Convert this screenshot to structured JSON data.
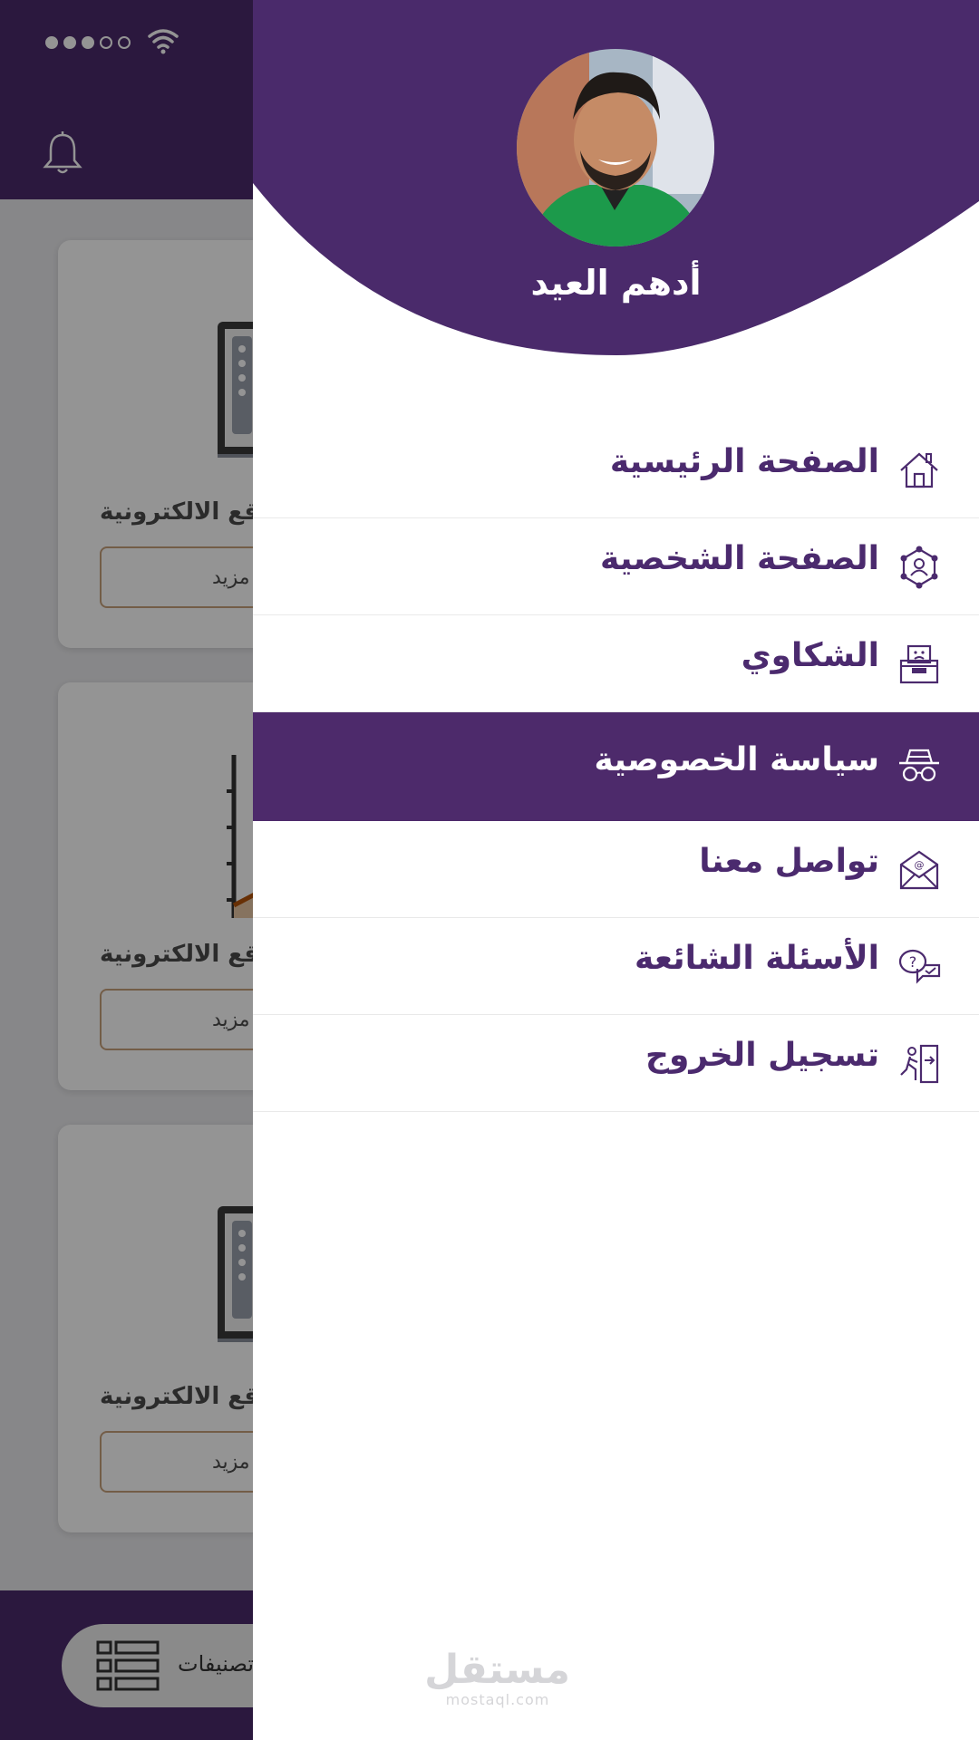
{
  "background": {
    "cards": [
      {
        "title": "قع الالكترونية",
        "button_label": "مزيد",
        "illustration": "monitor-illustration"
      },
      {
        "title": "قع الالكترونية",
        "button_label": "مزيد",
        "illustration": "chart-illustration"
      },
      {
        "title": "قع الالكترونية",
        "button_label": "مزيد",
        "illustration": "monitor-illustration"
      }
    ],
    "bottom_tab": {
      "label": "تصنيفات",
      "icon": "list-grid-icon"
    }
  },
  "drawer": {
    "user_name": "أدهم العيد",
    "menu": [
      {
        "label": "الصفحة الرئيسية",
        "icon": "home-icon",
        "active": false
      },
      {
        "label": "الصفحة الشخصية",
        "icon": "profile-network-icon",
        "active": false
      },
      {
        "label": "الشكاوي",
        "icon": "complaint-box-icon",
        "active": false
      },
      {
        "label": "سياسة الخصوصية",
        "icon": "incognito-icon",
        "active": true
      },
      {
        "label": "تواصل معنا",
        "icon": "mail-at-icon",
        "active": false
      },
      {
        "label": "الأسئلة الشائعة",
        "icon": "faq-chat-icon",
        "active": false
      },
      {
        "label": "تسجيل الخروج",
        "icon": "logout-icon",
        "active": false
      }
    ]
  },
  "watermark": {
    "arabic": "مستقل",
    "latin": "mostaql.com"
  },
  "colors": {
    "primary": "#4a2a6b",
    "active_item": "#4d2a6b",
    "text_primary": "#4b2a6e",
    "card_button_border": "#c7a07a"
  }
}
